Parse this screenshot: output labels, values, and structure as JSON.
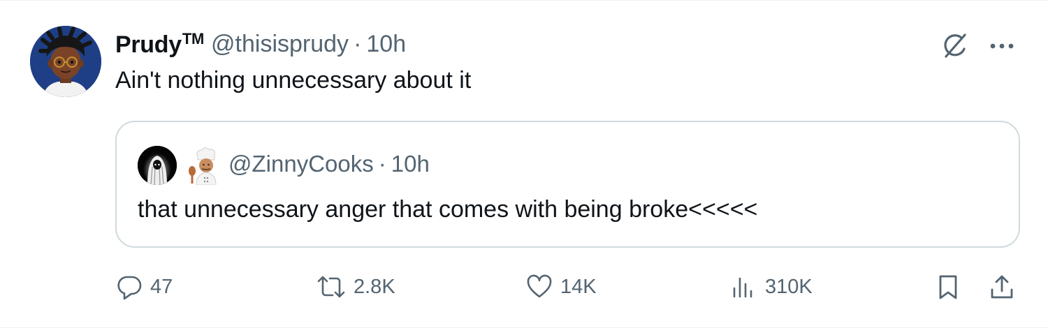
{
  "author": {
    "name": "Prudy",
    "badge": "TM",
    "handle": "@thisisprudy",
    "separator": "·",
    "time": "10h"
  },
  "post": {
    "text": "Ain't nothing unnecessary about it"
  },
  "quoted_post": {
    "handle": "@ZinnyCooks",
    "separator": "·",
    "time": "10h",
    "text": "that unnecessary anger that comes with being broke<<<<<",
    "emoji_icon": "cook-emoji-icon"
  },
  "actions": {
    "replies": "47",
    "reposts": "2.8K",
    "likes": "14K",
    "views": "310K"
  },
  "icons": {
    "grok": "grok-icon",
    "more": "more-icon",
    "reply": "reply-icon",
    "repost": "repost-icon",
    "like": "heart-icon",
    "views": "views-icon",
    "bookmark": "bookmark-icon",
    "share": "share-icon"
  },
  "colors": {
    "text": "#0f1419",
    "secondary": "#536471",
    "border": "#cfd9de",
    "avatar_bg": "#1e3f86"
  }
}
